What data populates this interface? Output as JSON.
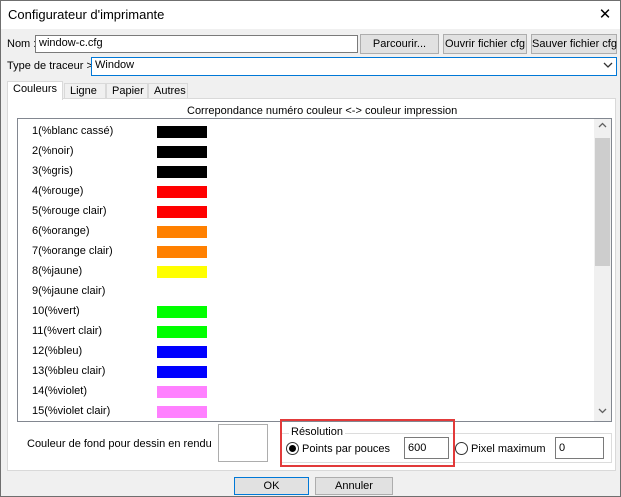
{
  "window": {
    "title": "Configurateur d'imprimante",
    "close_glyph": "✕"
  },
  "nom": {
    "label": "Nom :",
    "value": "window-c.cfg"
  },
  "buttons": {
    "browse": "Parcourir...",
    "open_cfg": "Ouvrir fichier cfg",
    "save_cfg": "Sauver fichier cfg"
  },
  "plotter": {
    "label": "Type de traceur >",
    "value": "Window"
  },
  "tabs": [
    {
      "label": "Couleurs"
    },
    {
      "label": "Ligne"
    },
    {
      "label": "Papier"
    },
    {
      "label": "Autres"
    }
  ],
  "colors_panel": {
    "heading": "Correpondance numéro couleur <-> couleur impression",
    "rows": [
      {
        "label": "1(%blanc cassé)",
        "color": "#000000"
      },
      {
        "label": "2(%noir)",
        "color": "#000000"
      },
      {
        "label": "3(%gris)",
        "color": "#000000"
      },
      {
        "label": "4(%rouge)",
        "color": "#ff0000"
      },
      {
        "label": "5(%rouge clair)",
        "color": "#ff0000"
      },
      {
        "label": "6(%orange)",
        "color": "#ff8000"
      },
      {
        "label": "7(%orange clair)",
        "color": "#ff8000"
      },
      {
        "label": "8(%jaune)",
        "color": "#ffff00"
      },
      {
        "label": "9(%jaune clair)",
        "color": "#ffffff"
      },
      {
        "label": "10(%vert)",
        "color": "#00ff00"
      },
      {
        "label": "11(%vert clair)",
        "color": "#00ff00"
      },
      {
        "label": "12(%bleu)",
        "color": "#0000ff"
      },
      {
        "label": "13(%bleu clair)",
        "color": "#0000ff"
      },
      {
        "label": "14(%violet)",
        "color": "#ff80ff"
      },
      {
        "label": "15(%violet clair)",
        "color": "#ff80ff"
      }
    ]
  },
  "background": {
    "label": "Couleur de fond pour dessin en rendu"
  },
  "resolution": {
    "title": "Résolution",
    "dpi_label": "Points par pouces",
    "dpi_value": "600",
    "pixel_label": "Pixel maximum",
    "pixel_value": "0"
  },
  "footer": {
    "ok": "OK",
    "cancel": "Annuler"
  }
}
